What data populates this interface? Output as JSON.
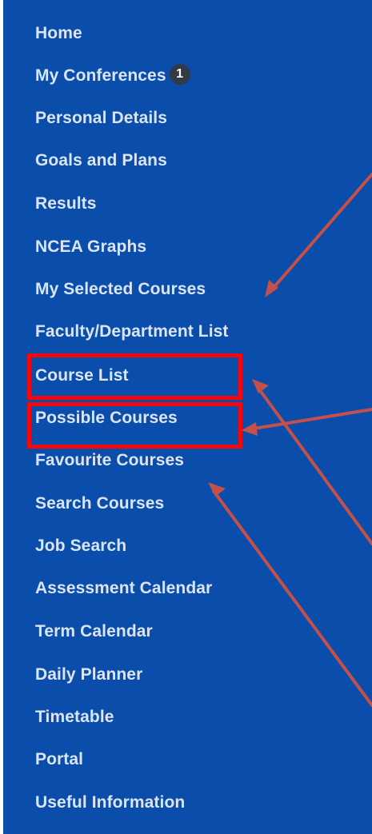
{
  "sidebar": {
    "items": [
      {
        "label": "Home"
      },
      {
        "label": "My Conferences",
        "badge": "1"
      },
      {
        "label": "Personal Details"
      },
      {
        "label": "Goals and Plans"
      },
      {
        "label": "Results"
      },
      {
        "label": "NCEA Graphs"
      },
      {
        "label": "My Selected Courses"
      },
      {
        "label": "Faculty/Department List"
      },
      {
        "label": "Course List"
      },
      {
        "label": "Possible Courses"
      },
      {
        "label": "Favourite Courses"
      },
      {
        "label": "Search Courses"
      },
      {
        "label": "Job Search"
      },
      {
        "label": "Assessment Calendar"
      },
      {
        "label": "Term Calendar"
      },
      {
        "label": "Daily Planner"
      },
      {
        "label": "Timetable"
      },
      {
        "label": "Portal"
      },
      {
        "label": "Useful Information"
      }
    ]
  },
  "colors": {
    "sidebar_background": "#0a4dab",
    "item_text": "#dbe5f5",
    "badge_background": "#333a44",
    "highlight_box": "#f4070d",
    "annotation_arrow": "#c5504a"
  }
}
